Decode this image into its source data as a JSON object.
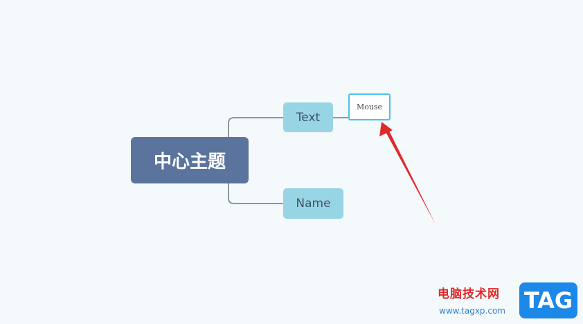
{
  "mindmap": {
    "central_topic": "中心主题",
    "subtopics": [
      {
        "label": "Text"
      },
      {
        "label": "Name"
      }
    ],
    "floating_topic": {
      "value": "Mouse"
    }
  },
  "annotation": {
    "icon": "red-arrow-icon",
    "color": "#e02a2a"
  },
  "watermark": {
    "title": "电脑技术网",
    "url": "www.tagxp.com",
    "badge": "TAG"
  },
  "colors": {
    "background": "#f4f9fc",
    "central_topic": "#5b749d",
    "subtopic": "#97d4e4",
    "connector": "#8e969c",
    "editing_border": "#4fc0e6"
  }
}
